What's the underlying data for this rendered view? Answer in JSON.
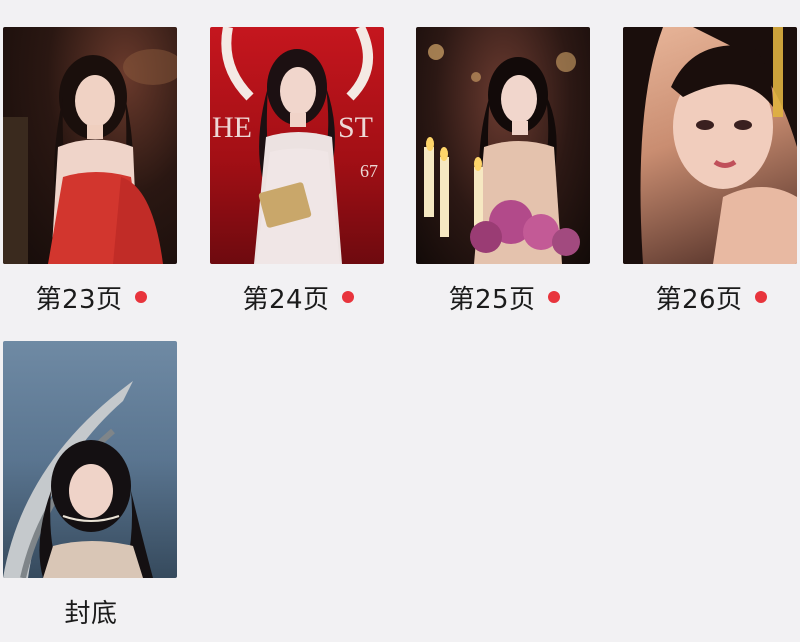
{
  "pages": [
    {
      "label": "第23页",
      "has_new_badge": true,
      "image": "page-23-thumbnail"
    },
    {
      "label": "第24页",
      "has_new_badge": true,
      "image": "page-24-thumbnail"
    },
    {
      "label": "第25页",
      "has_new_badge": true,
      "image": "page-25-thumbnail"
    },
    {
      "label": "第26页",
      "has_new_badge": true,
      "image": "page-26-thumbnail"
    },
    {
      "label": "封底",
      "has_new_badge": false,
      "image": "back-cover-thumbnail"
    }
  ],
  "colors": {
    "background": "#f2f1f3",
    "badge": "#e8343c",
    "label_text": "#1b1b1b"
  }
}
